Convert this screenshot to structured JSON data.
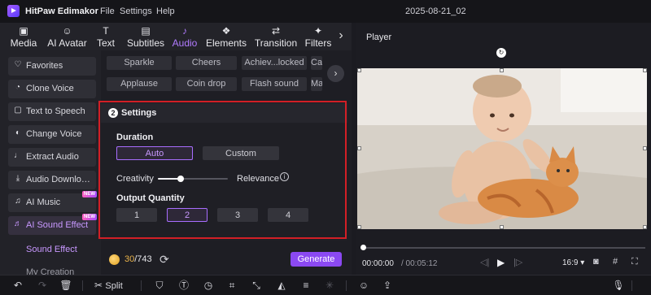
{
  "app": {
    "name": "HitPaw Edimakor",
    "project_title": "2025-08-21_02"
  },
  "menu": [
    "File",
    "Settings",
    "Help"
  ],
  "tabs": [
    {
      "label": "Media",
      "icon": "media-icon",
      "glyph": "▣"
    },
    {
      "label": "AI Avatar",
      "icon": "ai-avatar-icon",
      "glyph": "☺"
    },
    {
      "label": "Text",
      "icon": "text-icon",
      "glyph": "T"
    },
    {
      "label": "Subtitles",
      "icon": "subtitles-icon",
      "glyph": "▤"
    },
    {
      "label": "Audio",
      "icon": "audio-icon",
      "glyph": "♪"
    },
    {
      "label": "Elements",
      "icon": "elements-icon",
      "glyph": "❖"
    },
    {
      "label": "Transition",
      "icon": "transition-icon",
      "glyph": "⇄"
    },
    {
      "label": "Filters",
      "icon": "filters-icon",
      "glyph": "✦"
    }
  ],
  "active_tab": "Audio",
  "sidebar": {
    "items": [
      {
        "label": "Favorites",
        "icon": "heart-icon",
        "glyph": "♡"
      },
      {
        "label": "Clone Voice",
        "icon": "clone-voice-icon",
        "glyph": "◔"
      },
      {
        "label": "Text to Speech",
        "icon": "text-to-speech-icon",
        "glyph": "▢"
      },
      {
        "label": "Change Voice",
        "icon": "change-voice-icon",
        "glyph": "◐"
      },
      {
        "label": "Extract Audio",
        "icon": "microphone-icon",
        "glyph": "♩"
      },
      {
        "label": "Audio Downlo…",
        "icon": "download-icon",
        "glyph": "⤓"
      },
      {
        "label": "AI Music",
        "icon": "ai-music-icon",
        "glyph": "♫",
        "badge": "NEW"
      },
      {
        "label": "AI Sound Effect",
        "icon": "ai-sound-effect-icon",
        "glyph": "♬",
        "badge": "NEW"
      }
    ],
    "sub_items": [
      "Sound Effect",
      "My Creation"
    ]
  },
  "sound_effects": {
    "row1": [
      "Sparkle",
      "Cheers",
      "Achiev...locked",
      "Ca"
    ],
    "row2": [
      "Applause",
      "Coin drop",
      "Flash sound",
      "Ma"
    ]
  },
  "settings": {
    "step_number": "2",
    "title": "Settings",
    "duration_label": "Duration",
    "duration_options": [
      "Auto",
      "Custom"
    ],
    "duration_selected": "Auto",
    "creativity_label": "Creativity",
    "relevance_label": "Relevance",
    "slider_value": 0.32,
    "info_glyph": "i",
    "output_quantity_label": "Output Quantity",
    "quantity_options": [
      "1",
      "2",
      "3",
      "4"
    ],
    "quantity_selected": "2"
  },
  "credits": {
    "used": "30",
    "total": "/743"
  },
  "generate_label": "Generate",
  "player": {
    "title": "Player",
    "progress": 0.0,
    "time_current": "00:00:00",
    "time_total": "/ 00:05:12",
    "aspect_ratio": "16:9"
  },
  "toolbar": {
    "split_label": "Split"
  },
  "colors": {
    "accent": "#8b49f2",
    "accent_text": "#c898ff",
    "highlight": "#d21f26",
    "coin": "#e9b34a"
  }
}
